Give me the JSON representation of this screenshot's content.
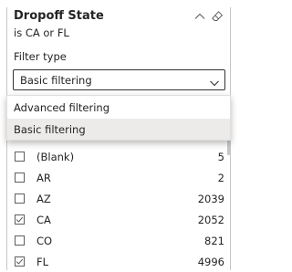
{
  "header": {
    "title": "Dropoff State",
    "subtitle": "is CA or FL",
    "icons": [
      "collapse-chevron-up-icon",
      "clear-filter-eraser-icon"
    ]
  },
  "filter_type": {
    "label": "Filter type",
    "selected": "Basic filtering",
    "options": [
      {
        "label": "Advanced filtering",
        "selected": false
      },
      {
        "label": "Basic filtering",
        "selected": true
      }
    ]
  },
  "values": [
    {
      "label": "(Blank)",
      "count": "5",
      "checked": false
    },
    {
      "label": "AR",
      "count": "2",
      "checked": false
    },
    {
      "label": "AZ",
      "count": "2039",
      "checked": false
    },
    {
      "label": "CA",
      "count": "2052",
      "checked": true
    },
    {
      "label": "CO",
      "count": "821",
      "checked": false
    },
    {
      "label": "FL",
      "count": "4996",
      "checked": true
    }
  ],
  "colors": {
    "text": "#252423",
    "border": "#c8c6c4",
    "selected_bg": "#edebe9",
    "checkbox_border": "#605e5c"
  }
}
